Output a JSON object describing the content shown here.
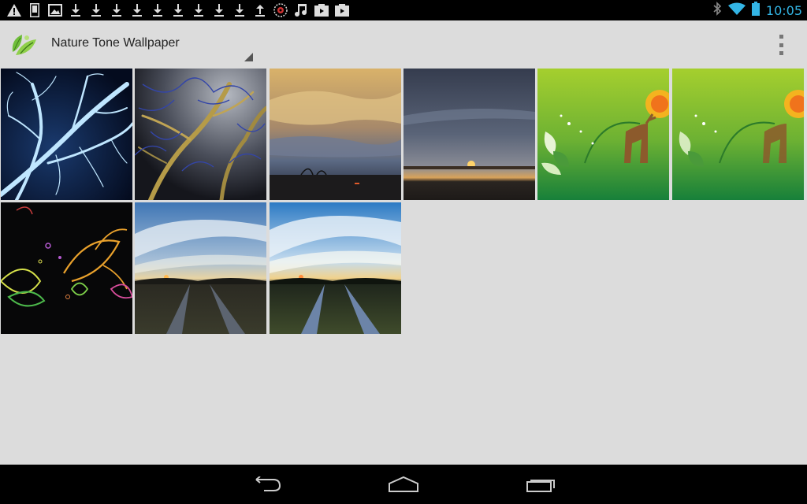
{
  "status_bar": {
    "left_icons": [
      "warning-icon",
      "phone-icon",
      "image-icon",
      "download-icon",
      "download-icon",
      "download-icon",
      "download-icon",
      "download-icon",
      "download-icon",
      "download-icon",
      "download-icon",
      "download-icon",
      "upload-icon",
      "disc-icon",
      "music-icon",
      "video-icon",
      "video-icon"
    ],
    "right_icons": [
      "bluetooth-icon",
      "wifi-icon",
      "battery-icon"
    ],
    "time": "10:05"
  },
  "action_bar": {
    "app_icon": "leaf-icon",
    "title": "Nature Tone Wallpaper",
    "overflow_icon": "overflow-menu-icon"
  },
  "gallery": {
    "items": [
      {
        "name": "wallpaper-blue-tree"
      },
      {
        "name": "wallpaper-dark-tree"
      },
      {
        "name": "wallpaper-cloudy-sunset"
      },
      {
        "name": "wallpaper-horizon-sunset"
      },
      {
        "name": "wallpaper-green-deer"
      },
      {
        "name": "wallpaper-green-deer-2"
      },
      {
        "name": "wallpaper-neon-leaves"
      },
      {
        "name": "wallpaper-dirt-road"
      },
      {
        "name": "wallpaper-dirt-road-hdr"
      }
    ]
  },
  "nav_bar": {
    "back_icon": "back-icon",
    "home_icon": "home-icon",
    "recents_icon": "recent-apps-icon"
  },
  "colors": {
    "status_clock": "#33b5e5",
    "background": "#dcdcdc"
  }
}
